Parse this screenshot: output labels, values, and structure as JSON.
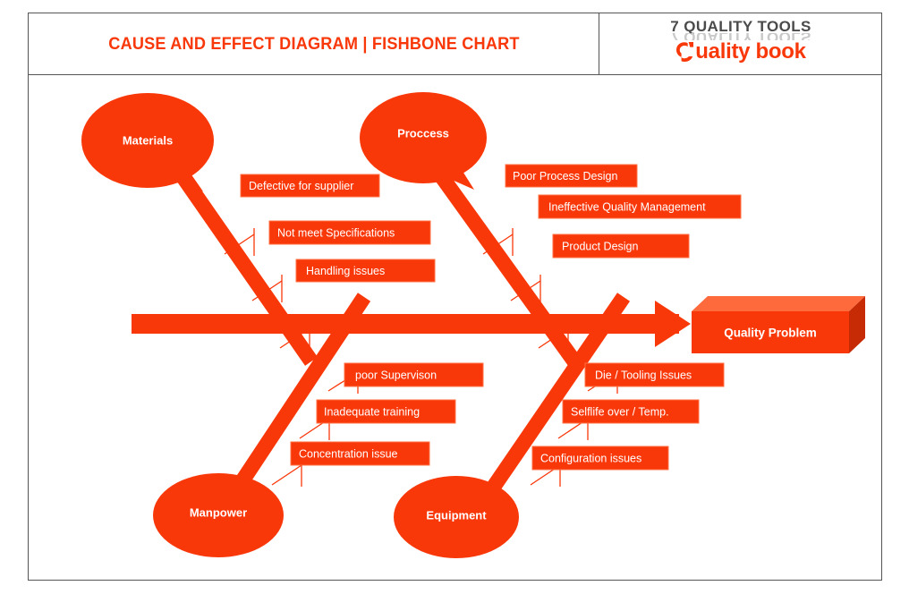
{
  "header": {
    "title": "CAUSE AND EFFECT DIAGRAM | FISHBONE CHART",
    "logo_top": "7 QUALITY TOOLS",
    "logo_bottom": "uality book",
    "logo_mark": "stylized-q-icon"
  },
  "colors": {
    "primary": "#F9380A",
    "box_border": "#FF7043",
    "top_face": "#FF6A3D",
    "side_face": "#C62B05",
    "frame": "#555555",
    "logo_gray": "#4a4a4a"
  },
  "diagram": {
    "effect": {
      "label": "Quality Problem"
    },
    "categories": [
      {
        "name": "Materials",
        "position": "top-left",
        "causes": [
          "Defective for supplier",
          "Not meet Specifications",
          "Handling issues"
        ]
      },
      {
        "name": "Proccess",
        "position": "top-right",
        "causes": [
          "Poor Process Design",
          "Ineffective Quality Management",
          "Product Design"
        ]
      },
      {
        "name": "Manpower",
        "position": "bottom-left",
        "causes": [
          "poor Supervison",
          "Inadequate training",
          "Concentration issue"
        ]
      },
      {
        "name": "Equipment",
        "position": "bottom-right",
        "causes": [
          "Die / Tooling Issues",
          "Selflife over / Temp.",
          "Configuration issues"
        ]
      }
    ]
  }
}
